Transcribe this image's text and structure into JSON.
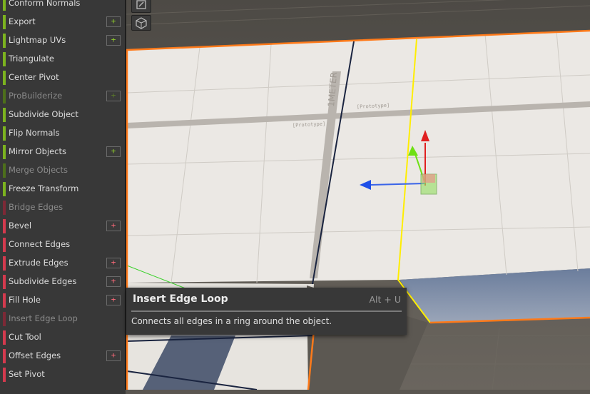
{
  "menu": {
    "items": [
      {
        "label": "Conform Normals",
        "category": "object",
        "enabled": true,
        "has_options": false
      },
      {
        "label": "Export",
        "category": "object",
        "enabled": true,
        "has_options": true
      },
      {
        "label": "Lightmap UVs",
        "category": "object",
        "enabled": true,
        "has_options": true
      },
      {
        "label": "Triangulate",
        "category": "object",
        "enabled": true,
        "has_options": false
      },
      {
        "label": "Center Pivot",
        "category": "object",
        "enabled": true,
        "has_options": false
      },
      {
        "label": "ProBuilderize",
        "category": "object",
        "enabled": false,
        "has_options": true
      },
      {
        "label": "Subdivide Object",
        "category": "object",
        "enabled": true,
        "has_options": false
      },
      {
        "label": "Flip Normals",
        "category": "object",
        "enabled": true,
        "has_options": false
      },
      {
        "label": "Mirror Objects",
        "category": "object",
        "enabled": true,
        "has_options": true
      },
      {
        "label": "Merge Objects",
        "category": "object",
        "enabled": false,
        "has_options": false
      },
      {
        "label": "Freeze Transform",
        "category": "object",
        "enabled": true,
        "has_options": false
      },
      {
        "label": "Bridge Edges",
        "category": "edge",
        "enabled": false,
        "has_options": false
      },
      {
        "label": "Bevel",
        "category": "edge",
        "enabled": true,
        "has_options": true
      },
      {
        "label": "Connect Edges",
        "category": "edge",
        "enabled": true,
        "has_options": false
      },
      {
        "label": "Extrude Edges",
        "category": "edge",
        "enabled": true,
        "has_options": true
      },
      {
        "label": "Subdivide Edges",
        "category": "edge",
        "enabled": true,
        "has_options": true
      },
      {
        "label": "Fill Hole",
        "category": "edge",
        "enabled": true,
        "has_options": true
      },
      {
        "label": "Insert Edge Loop",
        "category": "edge",
        "enabled": false,
        "has_options": false
      },
      {
        "label": "Cut Tool",
        "category": "edge",
        "enabled": true,
        "has_options": false
      },
      {
        "label": "Offset Edges",
        "category": "edge",
        "enabled": true,
        "has_options": true
      },
      {
        "label": "Set Pivot",
        "category": "edge",
        "enabled": true,
        "has_options": false
      }
    ],
    "plus_glyph": "+"
  },
  "tooltip": {
    "title": "Insert Edge Loop",
    "shortcut": "Alt + U",
    "description": "Connects all edges in a ring around the object."
  },
  "scene": {
    "prototype_label": "[Prototype]",
    "meter_label": "1METER"
  },
  "colors": {
    "object_accent": "#7cb31f",
    "edge_accent": "#d43a4e",
    "selection_outline": "#ff7a1a",
    "selected_edge": "#ffee00",
    "gizmo_x": "#e02020",
    "gizmo_y": "#6ee014",
    "gizmo_z": "#1e4fe8"
  },
  "toolbar": {
    "icons": [
      "maximize-icon",
      "cube-wire-icon"
    ]
  }
}
